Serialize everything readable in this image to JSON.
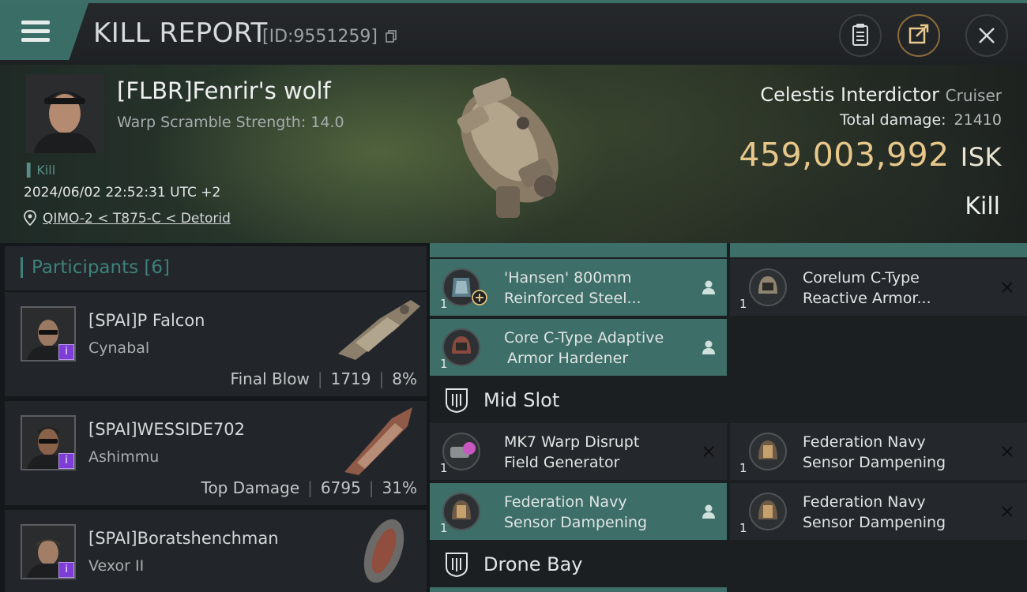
{
  "header": {
    "title": "KILL REPORT",
    "kill_id": "[ID:9551259]"
  },
  "victim": {
    "name": "[FLBR]Fenrir's wolf",
    "warp_scramble": "Warp Scramble Strength: 14.0",
    "kill_tag": "Kill",
    "date": "2024/06/02 22:52:31 UTC +2",
    "location": "QIMO-2 < T875-C < Detorid",
    "ship_name": "Celestis Interdictor",
    "ship_class": "Cruiser",
    "total_damage_label": "Total damage:",
    "total_damage": "21410",
    "isk_value": "459,003,992",
    "isk_unit": "ISK",
    "result": "Kill"
  },
  "participants": {
    "title": "Participants",
    "count": "[6]",
    "items": [
      {
        "name": "[SPAI]P Falcon",
        "ship": "Cynabal",
        "role": "Final Blow",
        "damage": "1719",
        "percent": "8%"
      },
      {
        "name": "[SPAI]WESSIDE702",
        "ship": "Ashimmu",
        "role": "Top Damage",
        "damage": "6795",
        "percent": "31%"
      },
      {
        "name": "[SPAI]Boratshenchman",
        "ship": "Vexor II",
        "role": "",
        "damage": "",
        "percent": ""
      }
    ]
  },
  "modules": {
    "low_slot": [
      {
        "qty": "1",
        "name_line1": "'Hansen' 800mm",
        "name_line2": "Reinforced Steel...",
        "state": "dropped"
      },
      {
        "qty": "1",
        "name_line1": "Corelum C-Type",
        "name_line2": "Reactive Armor...",
        "state": "destroyed"
      },
      {
        "qty": "1",
        "name_line1": "Core C-Type Adaptive",
        "name_line2": "Armor Hardener",
        "state": "dropped"
      }
    ],
    "mid_slot_title": "Mid Slot",
    "mid_slot": [
      {
        "qty": "1",
        "name_line1": "MK7 Warp Disrupt",
        "name_line2": "Field Generator",
        "state": "destroyed"
      },
      {
        "qty": "1",
        "name_line1": "Federation Navy",
        "name_line2": "Sensor Dampening",
        "state": "destroyed"
      },
      {
        "qty": "1",
        "name_line1": "Federation Navy",
        "name_line2": "Sensor Dampening",
        "state": "dropped"
      },
      {
        "qty": "1",
        "name_line1": "Federation Navy",
        "name_line2": "Sensor Dampening",
        "state": "destroyed"
      }
    ],
    "drone_bay_title": "Drone Bay"
  },
  "colors": {
    "accent": "#3d6e67",
    "isk": "#e7c78a",
    "badge": "#7e3dd6"
  }
}
